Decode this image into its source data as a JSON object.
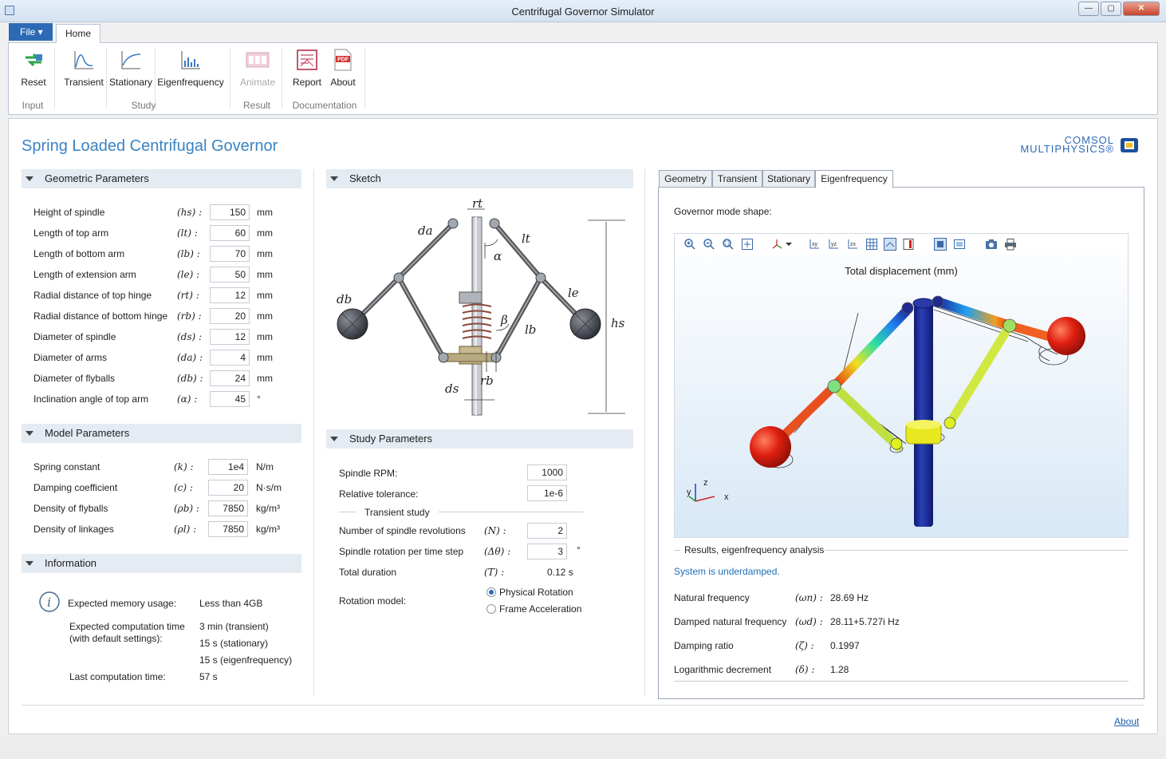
{
  "window": {
    "title": "Centrifugal Governor Simulator"
  },
  "ribbon": {
    "file_label": "File ▾",
    "home_tab": "Home",
    "buttons": {
      "reset": "Reset",
      "transient": "Transient",
      "stationary": "Stationary",
      "eigenfrequency": "Eigenfrequency",
      "animate": "Animate",
      "report": "Report",
      "about": "About"
    },
    "groups": {
      "input": "Input",
      "study": "Study",
      "result": "Result",
      "documentation": "Documentation"
    }
  },
  "app_title": "Spring Loaded Centrifugal Governor",
  "logo": {
    "line1": "COMSOL",
    "line2": "MULTIPHYSICS®"
  },
  "geometric": {
    "header": "Geometric Parameters",
    "rows": [
      {
        "label": "Height of spindle",
        "sym": "(hs) :",
        "value": "150",
        "unit": "mm"
      },
      {
        "label": "Length of top arm",
        "sym": "(lt) :",
        "value": "60",
        "unit": "mm"
      },
      {
        "label": "Length of bottom arm",
        "sym": "(lb) :",
        "value": "70",
        "unit": "mm"
      },
      {
        "label": "Length of extension arm",
        "sym": "(le) :",
        "value": "50",
        "unit": "mm"
      },
      {
        "label": "Radial distance of top hinge",
        "sym": "(rt) :",
        "value": "12",
        "unit": "mm"
      },
      {
        "label": "Radial distance of bottom hinge",
        "sym": "(rb) :",
        "value": "20",
        "unit": "mm"
      },
      {
        "label": "Diameter of spindle",
        "sym": "(ds) :",
        "value": "12",
        "unit": "mm"
      },
      {
        "label": "Diameter of arms",
        "sym": "(da) :",
        "value": "4",
        "unit": "mm"
      },
      {
        "label": "Diameter of flyballs",
        "sym": "(db) :",
        "value": "24",
        "unit": "mm"
      },
      {
        "label": "Inclination angle of top arm",
        "sym": "(α) :",
        "value": "45",
        "unit": "°"
      }
    ]
  },
  "model": {
    "header": "Model Parameters",
    "rows": [
      {
        "label": "Spring constant",
        "sym": "(k) :",
        "value": "1e4",
        "unit": "N/m"
      },
      {
        "label": "Damping coefficient",
        "sym": "(c) :",
        "value": "20",
        "unit": "N·s/m"
      },
      {
        "label": "Density of flyballs",
        "sym": "(ρb) :",
        "value": "7850",
        "unit": "kg/m³"
      },
      {
        "label": "Density of linkages",
        "sym": "(ρl) :",
        "value": "7850",
        "unit": "kg/m³"
      }
    ]
  },
  "information": {
    "header": "Information",
    "memory_label": "Expected memory usage:",
    "memory_value": "Less than 4GB",
    "time_label_1": "Expected computation time",
    "time_label_2": "(with default settings):",
    "time_transient": "3 min (transient)",
    "time_stationary": "15 s (stationary)",
    "time_eigen": "15 s (eigenfrequency)",
    "last_label": "Last computation time:",
    "last_value": "57 s"
  },
  "sketch": {
    "header": "Sketch",
    "labels": {
      "rt": "rt",
      "da": "da",
      "lt": "lt",
      "alpha": "α",
      "le": "le",
      "db": "db",
      "beta": "β",
      "lb": "lb",
      "hs": "hs",
      "rb": "rb",
      "ds": "ds"
    }
  },
  "study": {
    "header": "Study Parameters",
    "rpm_label": "Spindle RPM:",
    "rpm_value": "1000",
    "tol_label": "Relative tolerance:",
    "tol_value": "1e-6",
    "transient_label": "Transient study",
    "revs_label": "Number of spindle revolutions",
    "revs_sym": "(N) :",
    "revs_value": "2",
    "step_label": "Spindle rotation per time step",
    "step_sym": "(Δθ) :",
    "step_value": "3",
    "step_unit": "°",
    "dur_label": "Total duration",
    "dur_sym": "(T) :",
    "dur_value": "0.12 s",
    "rot_label": "Rotation model:",
    "rot_opt1": "Physical Rotation",
    "rot_opt2": "Frame Acceleration"
  },
  "tabs": [
    "Geometry",
    "Transient",
    "Stationary",
    "Eigenfrequency"
  ],
  "results": {
    "mode_shape_label": "Governor mode shape:",
    "plot_title": "Total displacement (mm)",
    "axes": {
      "z": "z",
      "y": "y",
      "x": "x"
    },
    "section_label": "Results, eigenfrequency analysis",
    "status": "System is underdamped.",
    "rows": [
      {
        "label": "Natural frequency",
        "sym": "(ωn) :",
        "value": "28.69 Hz"
      },
      {
        "label": "Damped natural frequency",
        "sym": "(ωd) :",
        "value": "28.11+5.727i Hz"
      },
      {
        "label": "Damping ratio",
        "sym": "(ζ) :",
        "value": "0.1997"
      },
      {
        "label": "Logarithmic decrement",
        "sym": "(δ) :",
        "value": "1.28"
      }
    ]
  },
  "footer": {
    "about_link": "About"
  },
  "colors": {
    "accent": "#3a83c3",
    "file_tab": "#2d6ab5",
    "status_text": "#1f6fb8"
  }
}
